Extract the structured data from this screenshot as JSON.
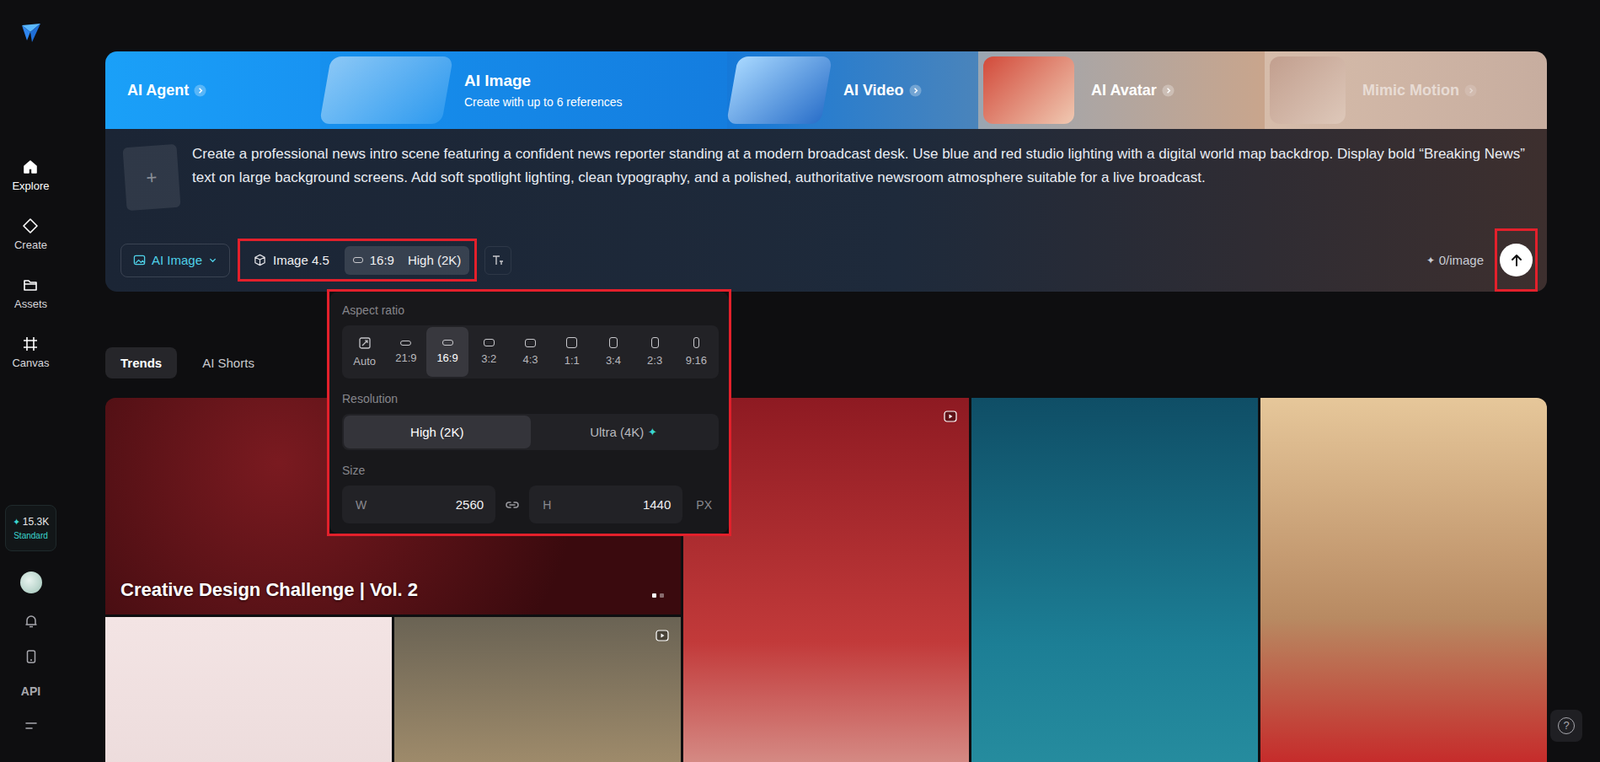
{
  "sidebar": {
    "items": [
      {
        "label": "Explore",
        "selected": true
      },
      {
        "label": "Create",
        "selected": false
      },
      {
        "label": "Assets",
        "selected": false
      },
      {
        "label": "Canvas",
        "selected": false
      }
    ],
    "credits": {
      "icon": "✦",
      "amount": "15.3K",
      "plan": "Standard"
    },
    "api": "API"
  },
  "banner": {
    "tabs": [
      {
        "label": "AI Agent",
        "subtitle": "",
        "selected": false,
        "disabled": false
      },
      {
        "label": "AI Image",
        "subtitle": "Create with up to 6 references",
        "selected": true,
        "disabled": false
      },
      {
        "label": "AI Video",
        "subtitle": "",
        "selected": false,
        "disabled": false
      },
      {
        "label": "AI Avatar",
        "subtitle": "",
        "selected": false,
        "disabled": false
      },
      {
        "label": "Mimic Motion",
        "subtitle": "",
        "selected": false,
        "disabled": true
      }
    ]
  },
  "prompt": {
    "add_icon": "+",
    "text": "Create a professional news intro scene featuring a confident news reporter standing at a modern broadcast desk. Use blue and red studio lighting with a digital world map backdrop. Display bold “Breaking News” text on large background screens. Add soft spotlight lighting, clean typography, and a polished, authoritative newsroom atmosphere suitable for a live broadcast.",
    "mode": "AI Image",
    "model": "Image 4.5",
    "ratio": "16:9",
    "resolution": "High (2K)",
    "settings_open": true,
    "settings_highlighted": true,
    "cost_icon": "✦",
    "cost": "0/image",
    "send_highlighted": true
  },
  "settings": {
    "highlighted": true,
    "aspect_title": "Aspect ratio",
    "ratios": [
      {
        "label": "Auto",
        "kind": "auto",
        "selected": false
      },
      {
        "label": "21:9",
        "kind": "ratio",
        "selected": false
      },
      {
        "label": "16:9",
        "kind": "ratio",
        "selected": true
      },
      {
        "label": "3:2",
        "kind": "ratio",
        "selected": false
      },
      {
        "label": "4:3",
        "kind": "ratio",
        "selected": false
      },
      {
        "label": "1:1",
        "kind": "ratio",
        "selected": false
      },
      {
        "label": "3:4",
        "kind": "ratio",
        "selected": false
      },
      {
        "label": "2:3",
        "kind": "ratio",
        "selected": false
      },
      {
        "label": "9:16",
        "kind": "ratio",
        "selected": false
      }
    ],
    "resolution_title": "Resolution",
    "resolutions": [
      {
        "label": "High (2K)",
        "selected": true,
        "badge": ""
      },
      {
        "label": "Ultra (4K)",
        "selected": false,
        "badge": "✦"
      }
    ],
    "size_title": "Size",
    "width_label": "W",
    "width": "2560",
    "height_label": "H",
    "height": "1440",
    "unit": "PX"
  },
  "feed": {
    "tabs": [
      {
        "label": "Trends",
        "selected": true
      },
      {
        "label": "AI Shorts",
        "selected": false
      }
    ],
    "cards": [
      {
        "kind": "feature",
        "caption": "Creative Design Challenge | Vol. 2",
        "video": false,
        "slides": [
          {
            "selected": true
          },
          {
            "selected": false
          }
        ]
      },
      {
        "kind": "tall",
        "caption": "",
        "video": true,
        "slides": []
      },
      {
        "kind": "tall",
        "caption": "",
        "video": false,
        "slides": []
      },
      {
        "kind": "tall",
        "caption": "",
        "video": false,
        "slides": []
      },
      {
        "kind": "small",
        "caption": "",
        "video": false,
        "slides": []
      },
      {
        "kind": "small",
        "caption": "",
        "video": true,
        "slides": []
      }
    ]
  },
  "help": {
    "icon": "?"
  }
}
